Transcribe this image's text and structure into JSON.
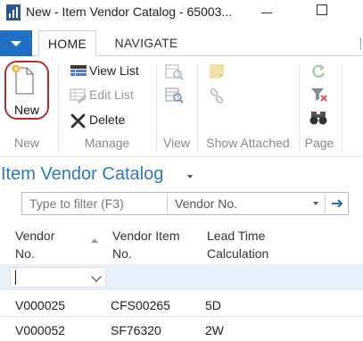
{
  "window": {
    "title": "New - Item Vendor Catalog - 65003..."
  },
  "ribbon": {
    "tabs": [
      {
        "label": "HOME"
      },
      {
        "label": "NAVIGATE"
      }
    ],
    "groups": {
      "new": {
        "label": "New",
        "button": "New"
      },
      "manage": {
        "label": "Manage",
        "view_list": "View List",
        "edit_list": "Edit List",
        "delete": "Delete"
      },
      "view": {
        "label": "View"
      },
      "show_attached": {
        "label": "Show Attached"
      },
      "page": {
        "label": "Page"
      }
    }
  },
  "page": {
    "caption": "Item Vendor Catalog"
  },
  "filter": {
    "placeholder": "Type to filter (F3)",
    "field": "Vendor No."
  },
  "table": {
    "headers": [
      {
        "line1": "Vendor",
        "line2": "No."
      },
      {
        "line1": "Vendor Item",
        "line2": "No."
      },
      {
        "line1": "Lead Time",
        "line2": "Calculation"
      }
    ],
    "rows": [
      {
        "vendor_no": "V000025",
        "vendor_item_no": "CFS00265",
        "lead_time": "5D"
      },
      {
        "vendor_no": "V000052",
        "vendor_item_no": "SF76320",
        "lead_time": "2W"
      }
    ]
  },
  "colors": {
    "accent": "#1f6fc4",
    "caption": "#2a79c7",
    "highlight": "#b03030",
    "new_row": "#e8f0fb"
  },
  "icons": [
    "app-icon",
    "new-document-icon",
    "view-list-icon",
    "edit-list-icon",
    "delete-icon",
    "view-icon",
    "view-list-alt-icon",
    "notes-icon",
    "links-icon",
    "refresh-icon",
    "clear-filter-icon",
    "find-icon",
    "filter-go-icon"
  ]
}
